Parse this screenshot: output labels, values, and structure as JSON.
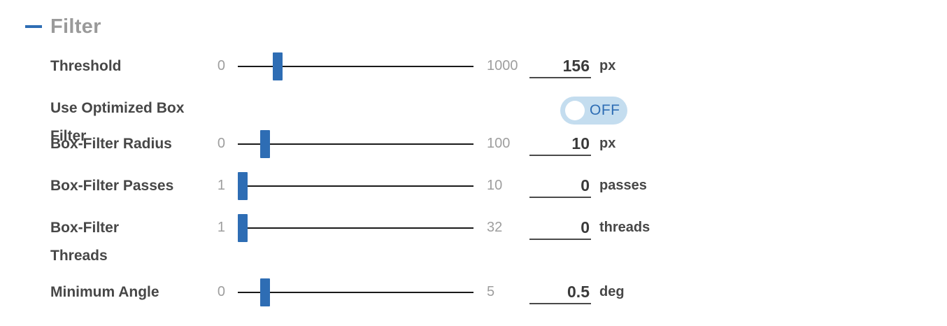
{
  "section": {
    "title": "Filter"
  },
  "rows": {
    "threshold": {
      "label": "Threshold",
      "min": "0",
      "max": "1000",
      "value": "156",
      "unit": "px",
      "fraction": 0.156
    },
    "optimized": {
      "label": "Use Optimized Box Filter",
      "toggle": "OFF"
    },
    "radius": {
      "label": "Box-Filter Radius",
      "min": "0",
      "max": "100",
      "value": "10",
      "unit": "px",
      "fraction": 0.1
    },
    "passes": {
      "label": "Box-Filter Passes",
      "min": "1",
      "max": "10",
      "value": "0",
      "unit": "passes",
      "fraction": 0.0
    },
    "threads": {
      "label_line1": "Box-Filter",
      "label_line2": "Threads",
      "min": "1",
      "max": "32",
      "value": "0",
      "unit": "threads",
      "fraction": 0.0
    },
    "angle": {
      "label": "Minimum Angle",
      "min": "0",
      "max": "5",
      "value": "0.5",
      "unit": "deg",
      "fraction": 0.1
    }
  }
}
